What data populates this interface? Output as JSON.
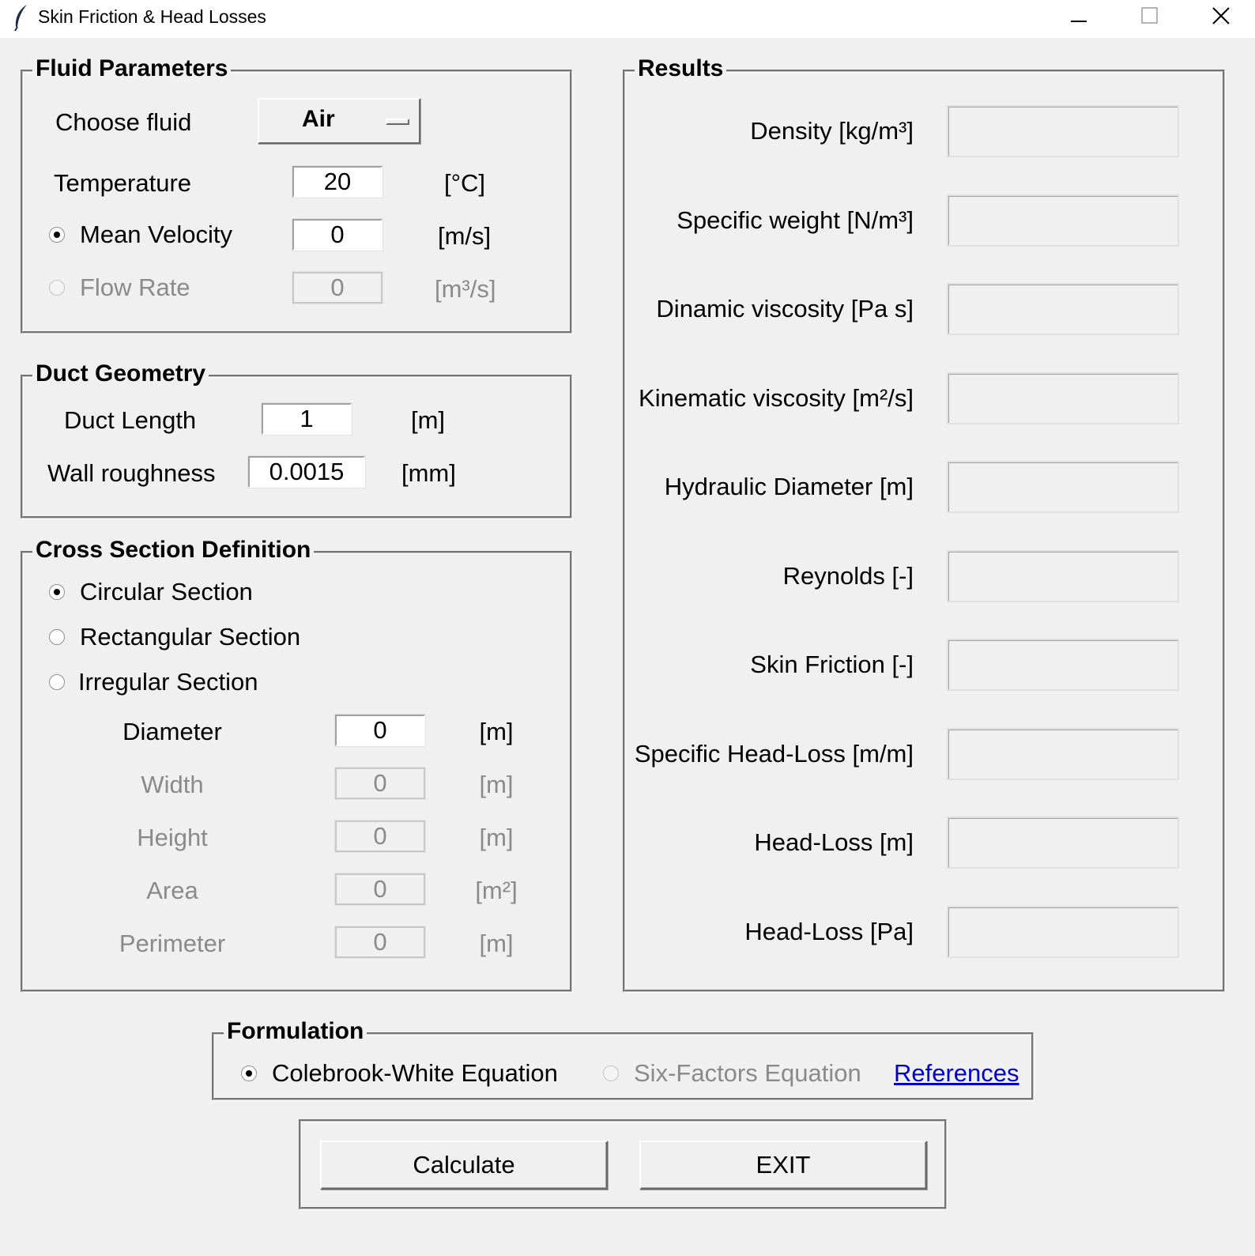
{
  "window": {
    "title": "Skin Friction & Head Losses"
  },
  "fluid_parameters": {
    "title": "Fluid Parameters",
    "choose_fluid_label": "Choose fluid",
    "fluid_selected": "Air",
    "temperature_label": "Temperature",
    "temperature_value": "20",
    "temperature_unit": "[°C]",
    "mean_velocity_label": "Mean Velocity",
    "mean_velocity_value": "0",
    "mean_velocity_unit": "[m/s]",
    "mean_velocity_selected": true,
    "flow_rate_label": "Flow Rate",
    "flow_rate_value": "0",
    "flow_rate_unit": "[m³/s]",
    "flow_rate_selected": false
  },
  "duct_geometry": {
    "title": "Duct Geometry",
    "length_label": "Duct Length",
    "length_value": "1",
    "length_unit": "[m]",
    "roughness_label": "Wall roughness",
    "roughness_value": "0.0015",
    "roughness_unit": "[mm]"
  },
  "cross_section": {
    "title": "Cross Section Definition",
    "options": [
      {
        "label": "Circular Section",
        "selected": true
      },
      {
        "label": "Rectangular Section",
        "selected": false
      },
      {
        "label": "Irregular Section",
        "selected": false
      }
    ],
    "fields": [
      {
        "label": "Diameter",
        "value": "0",
        "unit": "[m]",
        "enabled": true
      },
      {
        "label": "Width",
        "value": "0",
        "unit": "[m]",
        "enabled": false
      },
      {
        "label": "Height",
        "value": "0",
        "unit": "[m]",
        "enabled": false
      },
      {
        "label": "Area",
        "value": "0",
        "unit": "[m²]",
        "enabled": false
      },
      {
        "label": "Perimeter",
        "value": "0",
        "unit": "[m]",
        "enabled": false
      }
    ]
  },
  "results": {
    "title": "Results",
    "items": [
      {
        "label": "Density [kg/m³]",
        "value": ""
      },
      {
        "label": "Specific weight [N/m³]",
        "value": ""
      },
      {
        "label": "Dinamic viscosity [Pa s]",
        "value": ""
      },
      {
        "label": "Kinematic viscosity [m²/s]",
        "value": ""
      },
      {
        "label": "Hydraulic Diameter [m]",
        "value": ""
      },
      {
        "label": "Reynolds [-]",
        "value": ""
      },
      {
        "label": "Skin Friction [-]",
        "value": ""
      },
      {
        "label": "Specific Head-Loss [m/m]",
        "value": ""
      },
      {
        "label": "Head-Loss [m]",
        "value": ""
      },
      {
        "label": "Head-Loss [Pa]",
        "value": ""
      }
    ]
  },
  "formulation": {
    "title": "Formulation",
    "colebrook_label": "Colebrook-White Equation",
    "colebrook_selected": true,
    "six_factors_label": "Six-Factors Equation",
    "six_factors_selected": false,
    "references_label": "References"
  },
  "actions": {
    "calculate_label": "Calculate",
    "exit_label": "EXIT"
  },
  "colors": {
    "background": "#f0f0f0",
    "disabled_text": "#8a8a8a",
    "link": "#0000c8"
  }
}
